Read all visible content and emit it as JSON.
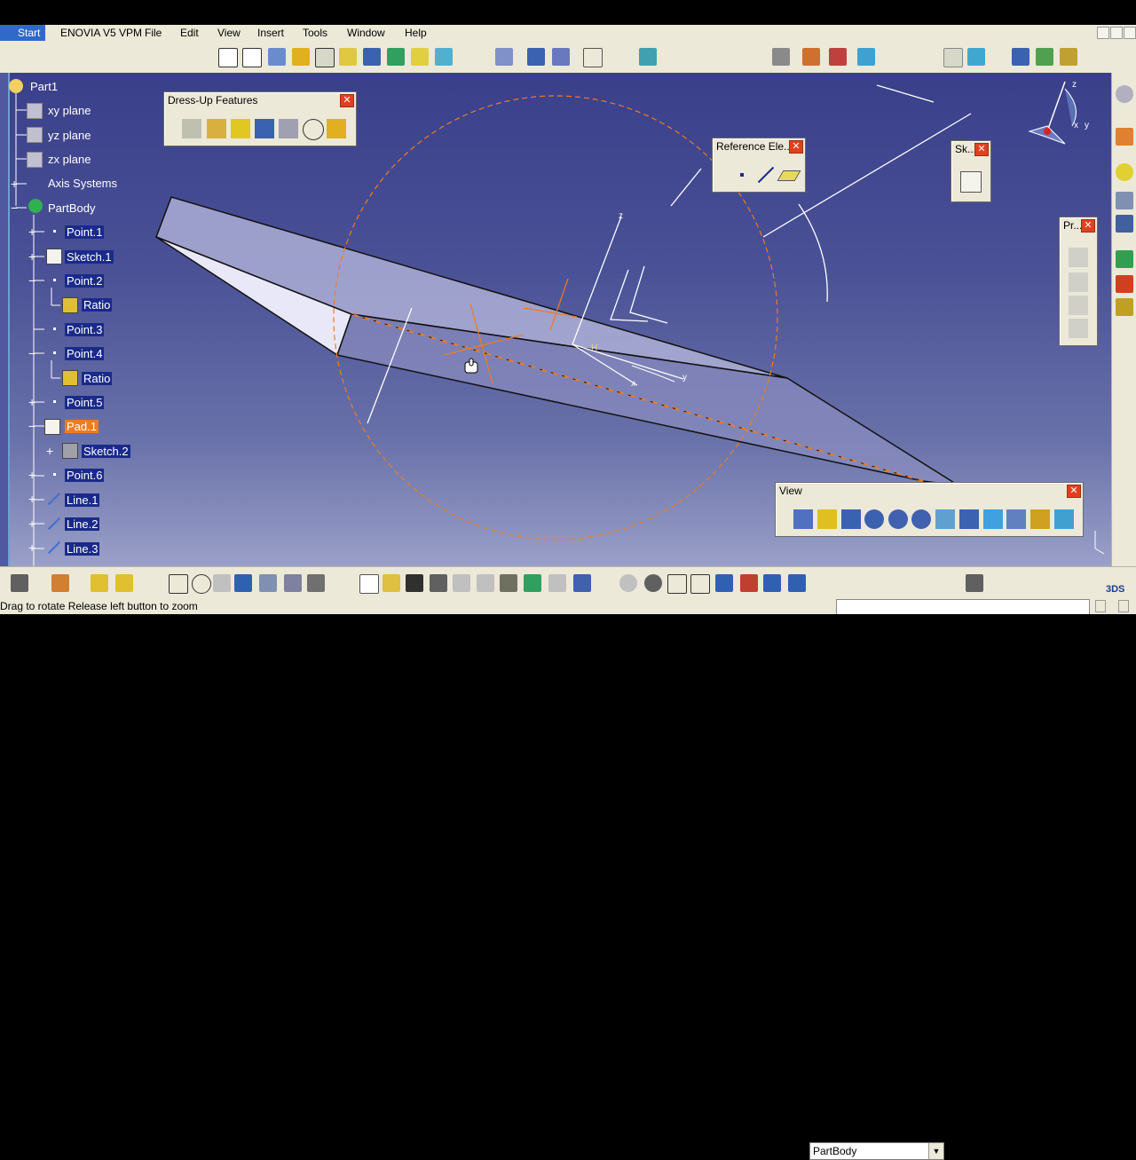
{
  "menubar": {
    "start": "Start",
    "items": [
      "ENOVIA V5 VPM",
      "File",
      "Edit",
      "View",
      "Insert",
      "Tools",
      "Window",
      "Help"
    ]
  },
  "tree": {
    "items": [
      {
        "label": "Part1",
        "kind": "root"
      },
      {
        "label": "xy plane",
        "kind": "plane"
      },
      {
        "label": "yz plane",
        "kind": "plane"
      },
      {
        "label": "zx plane",
        "kind": "plane"
      },
      {
        "label": "Axis Systems",
        "kind": "axis"
      },
      {
        "label": "PartBody",
        "kind": "body"
      },
      {
        "label": "Point.1",
        "kind": "point"
      },
      {
        "label": "Sketch.1",
        "kind": "sketch"
      },
      {
        "label": "Point.2",
        "kind": "point"
      },
      {
        "label": "Ratio",
        "kind": "ratio"
      },
      {
        "label": "Point.3",
        "kind": "point"
      },
      {
        "label": "Point.4",
        "kind": "point"
      },
      {
        "label": "Ratio",
        "kind": "ratio"
      },
      {
        "label": "Point.5",
        "kind": "point"
      },
      {
        "label": "Pad.1",
        "kind": "pad"
      },
      {
        "label": "Sketch.2",
        "kind": "sketch"
      },
      {
        "label": "Point.6",
        "kind": "point"
      },
      {
        "label": "Line.1",
        "kind": "line"
      },
      {
        "label": "Line.2",
        "kind": "line"
      },
      {
        "label": "Line.3",
        "kind": "line"
      }
    ]
  },
  "panels": {
    "dressup": {
      "title": "Dress-Up Features"
    },
    "reference": {
      "title": "Reference Ele..."
    },
    "sketcher": {
      "title": "Sk..."
    },
    "products": {
      "title": "Pr..."
    },
    "view": {
      "title": "View"
    }
  },
  "close_glyph": "✕",
  "viewport": {
    "axis_labels": {
      "z": "z",
      "x": "x",
      "y": "y",
      "h": "H"
    },
    "compass_labels": {
      "z": "z",
      "x": "x",
      "y": "y"
    }
  },
  "bottom": {
    "workbench_select": "PartBody"
  },
  "status": {
    "text": "Drag to rotate  Release left button to zoom"
  },
  "colors": {
    "accent": "#f07b1e",
    "selection": "#1a2a8a",
    "background_top": "#3a3f8a",
    "background_bottom": "#9aa0c8",
    "part_face": "#c9cbe6"
  }
}
